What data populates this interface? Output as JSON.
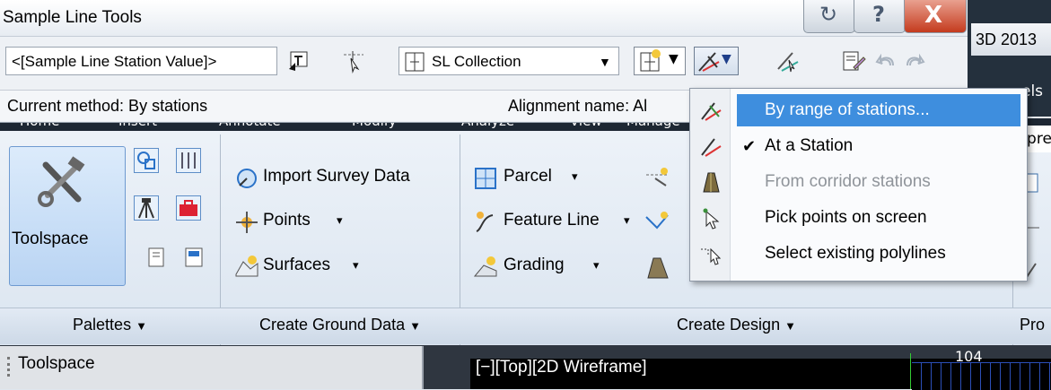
{
  "window": {
    "title": "Sample Line Tools",
    "help_glyph": "?",
    "close_glyph": "X"
  },
  "toolbar": {
    "station_field": "<[Sample Line Station Value]>",
    "collection_select": "SL Collection",
    "dropdown_glyph": "▼"
  },
  "status": {
    "method": "Current method: By stations",
    "alignment": "Alignment name: Al"
  },
  "right_strip": {
    "badge": "3D 2013",
    "partial_els": "els",
    "partial_pre": "xpre",
    "partial_pro": "Pro"
  },
  "ribbon": {
    "tabs_partial": [
      "Home",
      "Insert",
      "Annotate",
      "Modify",
      "Analyze",
      "View",
      "Manage"
    ],
    "toolspace_label": "Toolspace",
    "create_ground": {
      "import_survey": "Import Survey Data",
      "points": "Points",
      "surfaces": "Surfaces"
    },
    "create_design": {
      "parcel": "Parcel",
      "feature_line": "Feature Line",
      "grading": "Grading"
    },
    "panels": {
      "palettes": "Palettes",
      "create_ground_data": "Create Ground Data",
      "create_design": "Create Design"
    },
    "small_arrow": "▾",
    "panel_arrow": "▼"
  },
  "menu": {
    "items": [
      {
        "label": "By range of stations...",
        "state": "highlighted",
        "icon": "range-stations-icon"
      },
      {
        "label": "At a Station",
        "state": "checked",
        "icon": "station-icon"
      },
      {
        "label": "From corridor stations",
        "state": "disabled",
        "icon": "corridor-icon"
      },
      {
        "label": "Pick points on screen",
        "state": "normal",
        "icon": "pick-points-icon"
      },
      {
        "label": "Select existing polylines",
        "state": "normal",
        "icon": "polyline-icon"
      }
    ],
    "check_glyph": "✔"
  },
  "bottom": {
    "toolspace_title": "Toolspace",
    "viewport_label": "[−][Top][2D Wireframe]",
    "coord_label": "104"
  },
  "colors": {
    "menu_highlight": "#3e8ede",
    "close_button": "#c43b1e",
    "ribbon_selected": "#b9d4f3"
  }
}
